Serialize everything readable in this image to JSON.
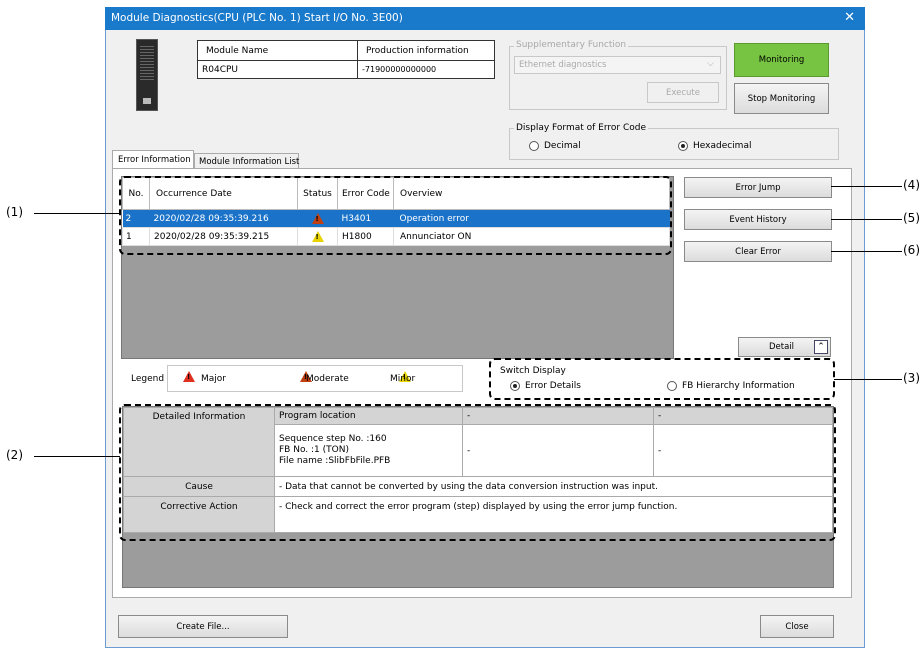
{
  "window": {
    "title": "Module Diagnostics(CPU (PLC No. 1) Start I/O No. 3E00)",
    "close_glyph": "✕"
  },
  "module_table": {
    "headers": [
      "Module Name",
      "Production information"
    ],
    "values": [
      "R04CPU",
      "-71900000000000"
    ]
  },
  "supplementary": {
    "legend": "Supplementary Function",
    "select_value": "Ethernet diagnostics",
    "execute_label": "Execute"
  },
  "monitoring": {
    "label": "Monitoring",
    "stop_label": "Stop Monitoring"
  },
  "error_format": {
    "legend": "Display Format of Error Code",
    "decimal": "Decimal",
    "hexadecimal": "Hexadecimal",
    "selected": "Hexadecimal"
  },
  "tabs": [
    "Error Information",
    "Module Information List"
  ],
  "error_list": {
    "headers": [
      "No.",
      "Occurrence Date",
      "Status",
      "Error Code",
      "Overview"
    ],
    "rows": [
      {
        "no": "2",
        "date": "2020/02/28 09:35:39.216",
        "status": "moderate",
        "code": "H3401",
        "overview": "Operation error"
      },
      {
        "no": "1",
        "date": "2020/02/28 09:35:39.215",
        "status": "minor",
        "code": "H1800",
        "overview": "Annunciator ON"
      }
    ]
  },
  "side_buttons": {
    "error_jump": "Error Jump",
    "event_history": "Event History",
    "clear_error": "Clear Error",
    "detail": "Detail"
  },
  "legend": {
    "title": "Legend",
    "major": "Major",
    "moderate": "Moderate",
    "minor": "Minor"
  },
  "switch_display": {
    "legend": "Switch Display",
    "error_details": "Error Details",
    "fb_hierarchy": "FB Hierarchy Information",
    "selected": "Error Details"
  },
  "details": {
    "detailed_info_label": "Detailed Information",
    "col_headers": [
      "Program location",
      "-",
      "-"
    ],
    "program_location": [
      "Sequence step No. :160",
      "FB No. :1 (TON)",
      "File name :SlibFbFile.PFB"
    ],
    "col2_value": "-",
    "col3_value": "-",
    "cause_label": "Cause",
    "cause_value": "- Data that cannot be converted by using the data conversion instruction was input.",
    "action_label": "Corrective Action",
    "action_value": "- Check and correct the error program (step) displayed by using the error jump function."
  },
  "bottom": {
    "create_file": "Create File...",
    "close": "Close"
  },
  "callouts": {
    "c1": "(1)",
    "c2": "(2)",
    "c3": "(3)",
    "c4": "(4)",
    "c5": "(5)",
    "c6": "(6)"
  },
  "colors": {
    "titlebar": "#1979ca",
    "monitoring": "#76c442",
    "selection": "#1a73c9",
    "grid_bg": "#9c9c9c"
  }
}
